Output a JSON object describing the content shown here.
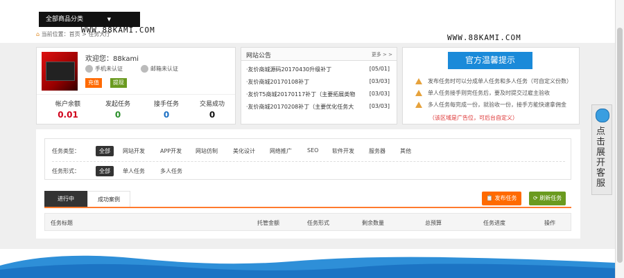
{
  "header": {
    "category_button": "全部商品分类",
    "breadcrumb_label": "当前位置：",
    "breadcrumb_home": "首页",
    "breadcrumb_sep": ">",
    "breadcrumb_current": "任务大厅"
  },
  "watermark": "WWW.88KAMI.COM",
  "user": {
    "welcome": "欢迎您：88kami",
    "phone_status": "手机未认证",
    "email_status": "邮箱未认证",
    "recharge_label": "充值",
    "withdraw_label": "提现",
    "stats": [
      {
        "label": "帐户余额",
        "value": "0.01"
      },
      {
        "label": "发起任务",
        "value": "0"
      },
      {
        "label": "接手任务",
        "value": "0"
      },
      {
        "label": "交易成功",
        "value": "0"
      }
    ]
  },
  "notice": {
    "title": "网站公告",
    "more": "更多 > >",
    "items": [
      {
        "text": "·友价商城源码20170430升级补丁",
        "date": "[05/01]"
      },
      {
        "text": "·友价商城20170108补丁",
        "date": "[03/03]"
      },
      {
        "text": "·友价T5商城20170117补丁（主要拓展类物",
        "date": "[03/03]"
      },
      {
        "text": "·友价商城20170208补丁（主要优化任务大",
        "date": "[03/03]"
      }
    ]
  },
  "tips": {
    "banner": "官方温馨提示",
    "items": [
      "发布任务时可以分成单人任务和多人任务（可自定义份数）",
      "单人任务接手则完任务后，要及时提交过雇主验收",
      "多人任务每完成一份，就验收一份，接手方能快速拿佣金"
    ],
    "ad_note": "（该区域是广告位，可后台自定义）"
  },
  "side_service": {
    "text": "点击展开客服"
  },
  "filters": {
    "type_label": "任务类型：",
    "type_options": [
      "全部",
      "网站开发",
      "APP开发",
      "网站仿制",
      "美化设计",
      "网络推广",
      "SEO",
      "软件开发",
      "服务器",
      "其他"
    ],
    "form_label": "任务形式：",
    "form_options": [
      "全部",
      "单人任务",
      "多人任务"
    ]
  },
  "tabs": [
    "进行中",
    "成功案例"
  ],
  "actions": {
    "publish": "发布任务",
    "refresh": "刷新任务"
  },
  "table": {
    "headers": [
      "任务标题",
      "托管金额",
      "任务形式",
      "剩余数量",
      "总预算",
      "任务进度",
      "操作"
    ]
  },
  "colors": {
    "balance_red": "#d0021b",
    "task_green": "#2a8f2a",
    "accept_blue": "#1a6fc4",
    "accent_orange": "#ff6a00",
    "refresh_green": "#6a9a1f",
    "tip_blue": "#1a8ad9"
  }
}
